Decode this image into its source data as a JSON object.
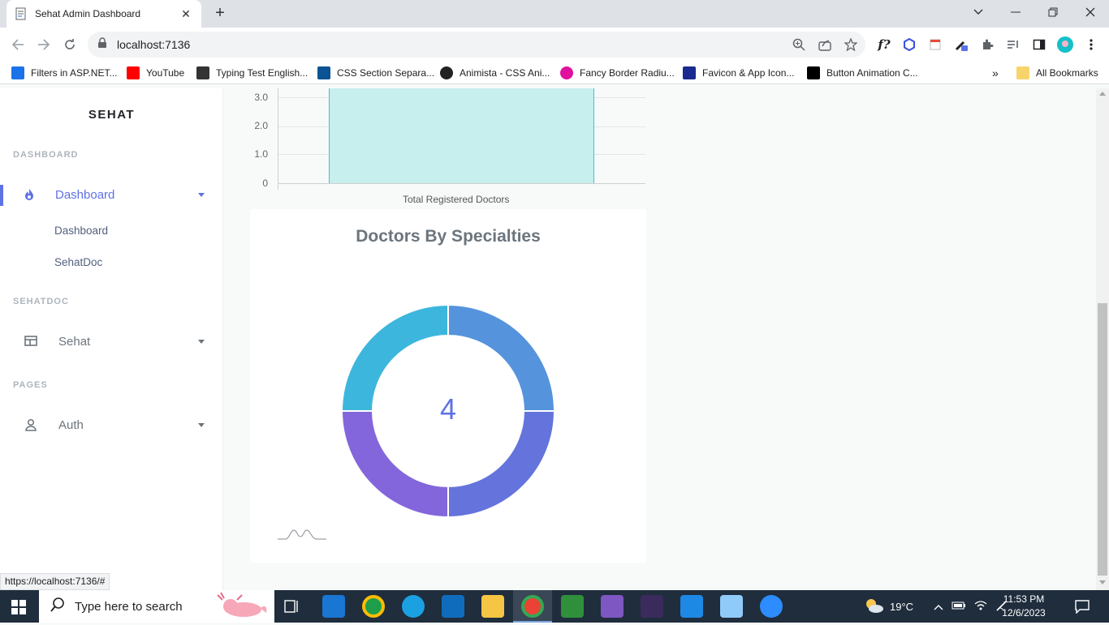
{
  "browser": {
    "tab_title": "Sehat Admin Dashboard",
    "url": "localhost:7136",
    "bookmarks": [
      {
        "label": "Filters in ASP.NET...",
        "color": "#1a73e8"
      },
      {
        "label": "YouTube",
        "color": "#ff0000"
      },
      {
        "label": "Typing Test English...",
        "color": "#333333"
      },
      {
        "label": "CSS Section Separa...",
        "color": "#0b5394"
      },
      {
        "label": "Animista - CSS Ani...",
        "color": "#222222"
      },
      {
        "label": "Fancy Border Radiu...",
        "color": "#e0119e"
      },
      {
        "label": "Favicon & App Icon...",
        "color": "#1b2a8f"
      },
      {
        "label": "Button Animation C...",
        "color": "#000000"
      }
    ],
    "all_bookmarks": "All Bookmarks",
    "status_url": "https://localhost:7136/#"
  },
  "sidebar": {
    "brand": "SEHAT",
    "sections": {
      "dashboard": "DASHBOARD",
      "sehatdoc": "SEHATDOC",
      "pages": "PAGES"
    },
    "items": {
      "dashboard": "Dashboard",
      "sub_dashboard": "Dashboard",
      "sub_sehatdoc": "SehatDoc",
      "sehat": "Sehat",
      "auth": "Auth"
    }
  },
  "chart_data": [
    {
      "type": "bar",
      "categories": [
        "Total Registered Doctors"
      ],
      "values": [
        4
      ],
      "yticks": [
        "3.0",
        "2.0",
        "1.0",
        "0"
      ]
    },
    {
      "type": "pie",
      "title": "Doctors By Specialties",
      "center_label": "4",
      "values": [
        1,
        1,
        1,
        1
      ],
      "colors": [
        "#5593dc",
        "#6474dc",
        "#8366dc",
        "#3db6dd"
      ]
    }
  ],
  "taskbar": {
    "search_placeholder": "Type here to search",
    "weather": "19°C",
    "time": "11:53 PM",
    "date": "12/6/2023"
  },
  "colors": {
    "accent": "#5e72e4",
    "bar_fill": "#c6efed",
    "bar_border": "#3ec5c9"
  }
}
